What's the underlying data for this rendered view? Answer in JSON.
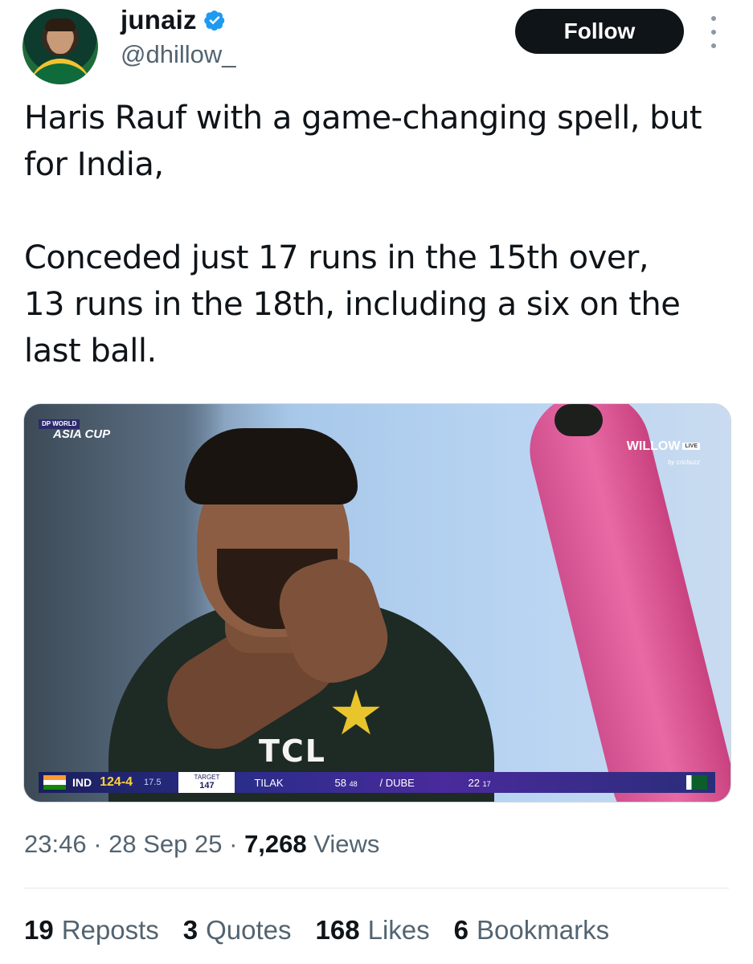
{
  "author": {
    "display_name": "junaiz",
    "handle": "@dhillow_",
    "verified": true,
    "avatar_icon": "profile-avatar"
  },
  "actions": {
    "follow_label": "Follow",
    "more_icon": "more-vertical-icon"
  },
  "tweet": {
    "text": "Haris Rauf with a game-changing spell, but for India,\n\nConceded just 17 runs in the 15th over,\n13 runs in the 18th, including a six on the last ball."
  },
  "media": {
    "event_logo_top": "DP WORLD",
    "event_logo_main": "ASIA CUP",
    "broadcaster": "WILLOW",
    "broadcaster_live": "LIVE",
    "broadcaster_sub": "by cricbuzz",
    "shirt_sponsor": "TCL",
    "scorebar": {
      "team": "IND",
      "score": "124-4",
      "overs": "17.5",
      "target_label": "TARGET",
      "target_value": "147",
      "batter1_name": "TILAK",
      "batter1_score": "58",
      "batter1_balls": "48",
      "batter2_name": "DUBE",
      "batter2_score": "22",
      "batter2_balls": "17"
    }
  },
  "meta": {
    "time": "23:46",
    "date": "28 Sep 25",
    "views_count": "7,268",
    "views_label": "Views"
  },
  "stats": [
    {
      "count": "19",
      "label": "Reposts"
    },
    {
      "count": "3",
      "label": "Quotes"
    },
    {
      "count": "168",
      "label": "Likes"
    },
    {
      "count": "6",
      "label": "Bookmarks"
    }
  ],
  "colors": {
    "follow_bg": "#0f1419",
    "secondary_text": "#536471",
    "verified_blue": "#1d9bf0"
  }
}
